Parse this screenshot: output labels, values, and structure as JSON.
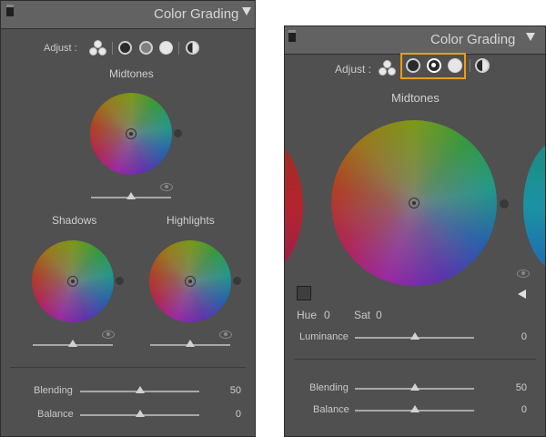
{
  "panel_title": "Color Grading",
  "adjust_label": "Adjust :",
  "left": {
    "midtones": "Midtones",
    "shadows": "Shadows",
    "highlights": "Highlights",
    "blending": {
      "label": "Blending",
      "value": "50"
    },
    "balance": {
      "label": "Balance",
      "value": "0"
    }
  },
  "right": {
    "midtones": "Midtones",
    "hue": {
      "label": "Hue",
      "value": "0"
    },
    "sat": {
      "label": "Sat",
      "value": "0"
    },
    "luminance": {
      "label": "Luminance",
      "value": "0"
    },
    "blending": {
      "label": "Blending",
      "value": "50"
    },
    "balance": {
      "label": "Balance",
      "value": "0"
    }
  },
  "highlight_color": "#f39c12"
}
